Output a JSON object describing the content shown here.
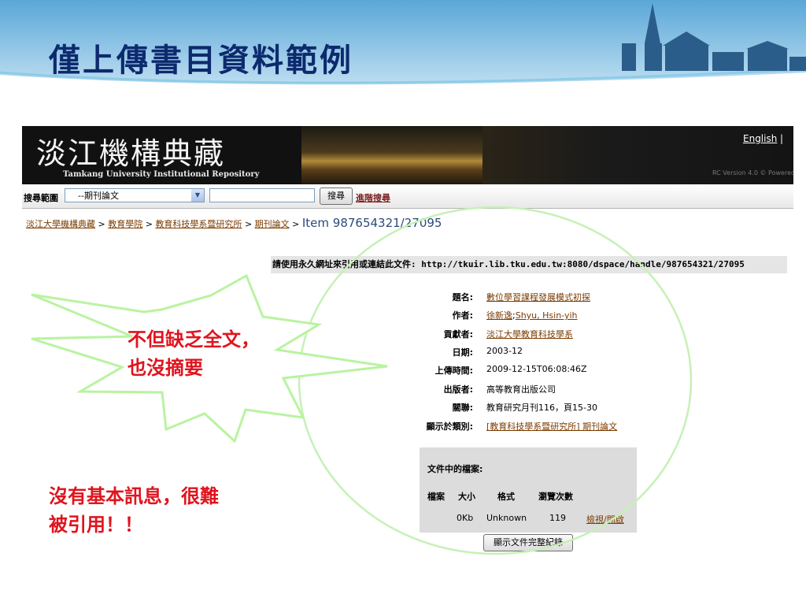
{
  "slide": {
    "title": "僅上傳書目資料範例"
  },
  "site": {
    "logo_title": "淡江機構典藏",
    "logo_subtitle": "Tamkang University Institutional Repository",
    "language_link": "English",
    "language_separator": "|",
    "version_text": "RC Version 4.0 © Powered"
  },
  "search": {
    "scope_label": "搜尋範圍",
    "scope_value": "--期刊論文",
    "button_label": "搜尋",
    "advanced_link": "進階搜尋"
  },
  "breadcrumb": {
    "items": [
      "淡江大學機構典藏",
      "教育學院",
      "教育科技學系暨研究所",
      "期刊論文"
    ],
    "separator": ">",
    "current": "Item 987654321/27095"
  },
  "record": {
    "permalink_text": "請使用永久網址來引用或連結此文件: http://tkuir.lib.tku.edu.tw:8080/dspace/handle/987654321/27095",
    "fields": [
      {
        "label": "題名:",
        "value": "數位學習課程發展模式初探"
      },
      {
        "label": "作者:",
        "value_1": "徐新逸",
        "value_sep": ";",
        "value_2": "Shyu, Hsin-yih"
      },
      {
        "label": "貢獻者:",
        "value": "淡江大學教育科技學系"
      },
      {
        "label": "日期:",
        "value": "2003-12"
      },
      {
        "label": "上傳時間:",
        "value": "2009-12-15T06:08:46Z"
      },
      {
        "label": "出版者:",
        "value": "高等教育出版公司"
      },
      {
        "label": "關聯:",
        "value": "教育研究月刊116，頁15-30"
      },
      {
        "label": "顯示於類別:",
        "value": "[教育科技學系暨研究所] 期刊論文"
      }
    ]
  },
  "files": {
    "title": "文件中的檔案:",
    "headers": [
      "檔案",
      "大小",
      "格式",
      "瀏覽次數"
    ],
    "row": {
      "size": "0Kb",
      "format": "Unknown",
      "views": "119",
      "action": "檢視/開啟"
    },
    "full_record_button": "顯示文件完整紀錄"
  },
  "annotations": {
    "star_line1": "不但缺乏全文，",
    "star_line2": "也沒摘要",
    "bottom_line1": "沒有基本訊息，很難",
    "bottom_line2": "被引用！！"
  },
  "colors": {
    "title_navy": "#0d2a6e",
    "annotation_red": "#e0141e",
    "burst_green": "#b9f3a0",
    "link_brown": "#7b3b00"
  }
}
